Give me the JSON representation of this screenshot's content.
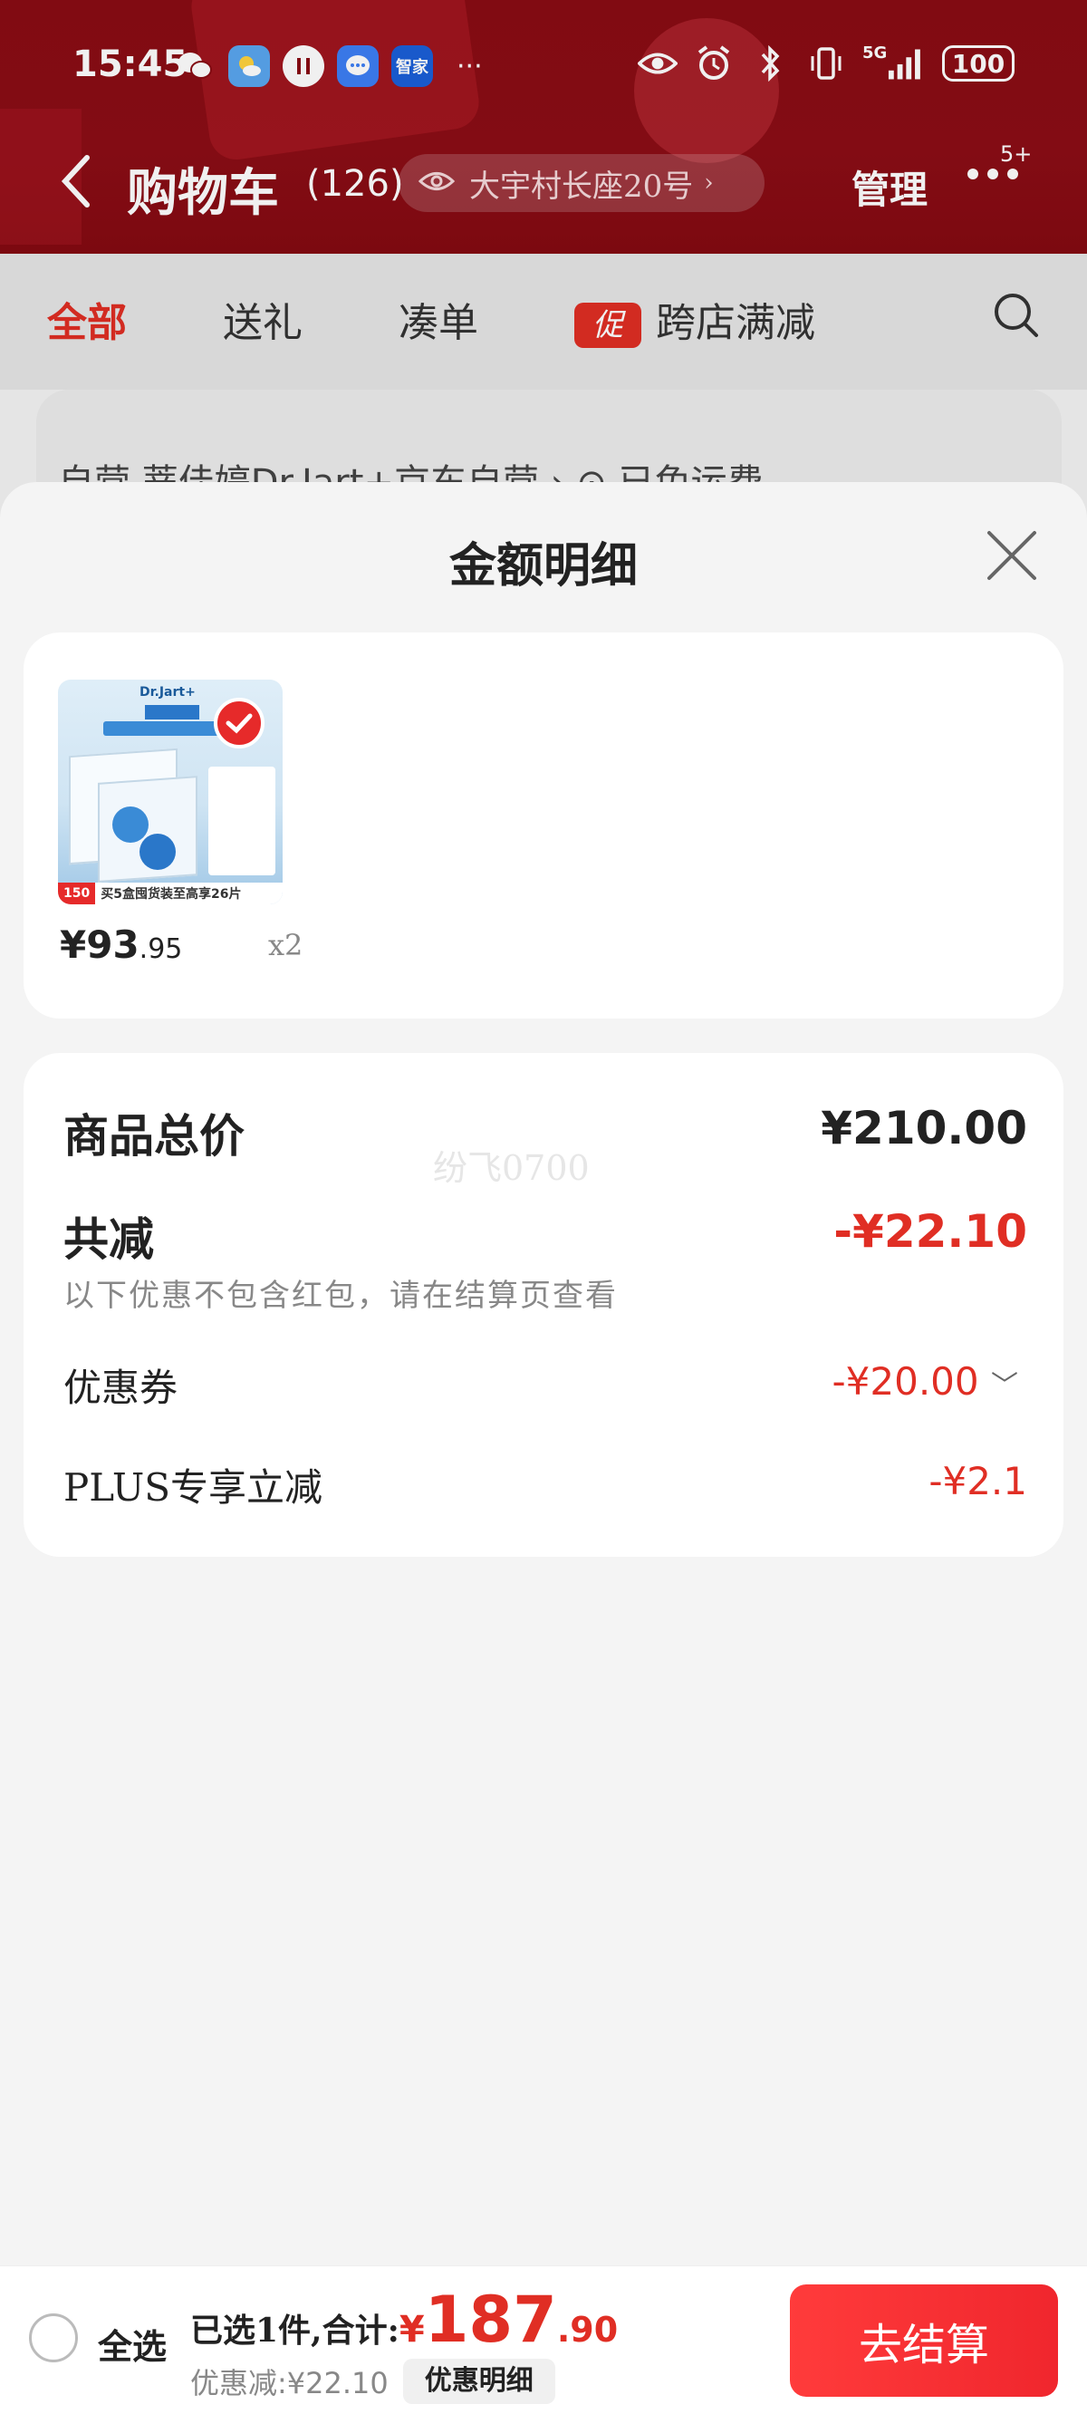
{
  "status_bar": {
    "time": "15:45",
    "apps": [
      "wechat-icon",
      "weather-icon",
      "pause-app-icon",
      "message-icon",
      "haier-smart-home-icon"
    ],
    "app_label_haier": "智家",
    "more": "···",
    "network": "5G",
    "battery": "100"
  },
  "header": {
    "title": "购物车",
    "count": "(126)",
    "address": "大宇村长座20号",
    "manage": "管理",
    "more_badge": "5+"
  },
  "tabs": [
    {
      "label": "全部",
      "active": true
    },
    {
      "label": "送礼",
      "active": false
    },
    {
      "label": "凑单",
      "active": false
    },
    {
      "label": "跨店满减",
      "promo_tag": "促",
      "active": false
    }
  ],
  "cart_peek": {
    "text": "自营 蒂佳婷Dr.Jart+京东自营 › ⊙ 已免运费"
  },
  "sheet": {
    "title": "金额明细",
    "product": {
      "image_brand": "Dr.Jart+",
      "image_bottom_badge": "150",
      "image_bottom_text": "买5盒囤货装至高享26片",
      "price_int": "¥93",
      "price_dec": ".95",
      "qty": "x2"
    },
    "summary": {
      "watermark": "纷飞0700",
      "total_label": "商品总价",
      "total_value": "¥210.00",
      "reduce_label": "共减",
      "reduce_value": "-¥22.10",
      "reduce_note": "以下优惠不包含红包，请在结算页查看",
      "coupon_label": "优惠券",
      "coupon_value": "-¥20.00",
      "plus_label": "PLUS专享立减",
      "plus_value": "-¥2.1"
    }
  },
  "bottom_bar": {
    "select_all": "全选",
    "selected_prefix": "已选1件,合计:",
    "yen": "¥",
    "total_int": "187",
    "total_dec": ".90",
    "discount_text": "优惠减:¥22.10",
    "detail_button": "优惠明细",
    "checkout": "去结算"
  },
  "colors": {
    "header_bg": "#8a0c14",
    "accent_red": "#e02e24",
    "checkout_red": "#f0262d"
  }
}
